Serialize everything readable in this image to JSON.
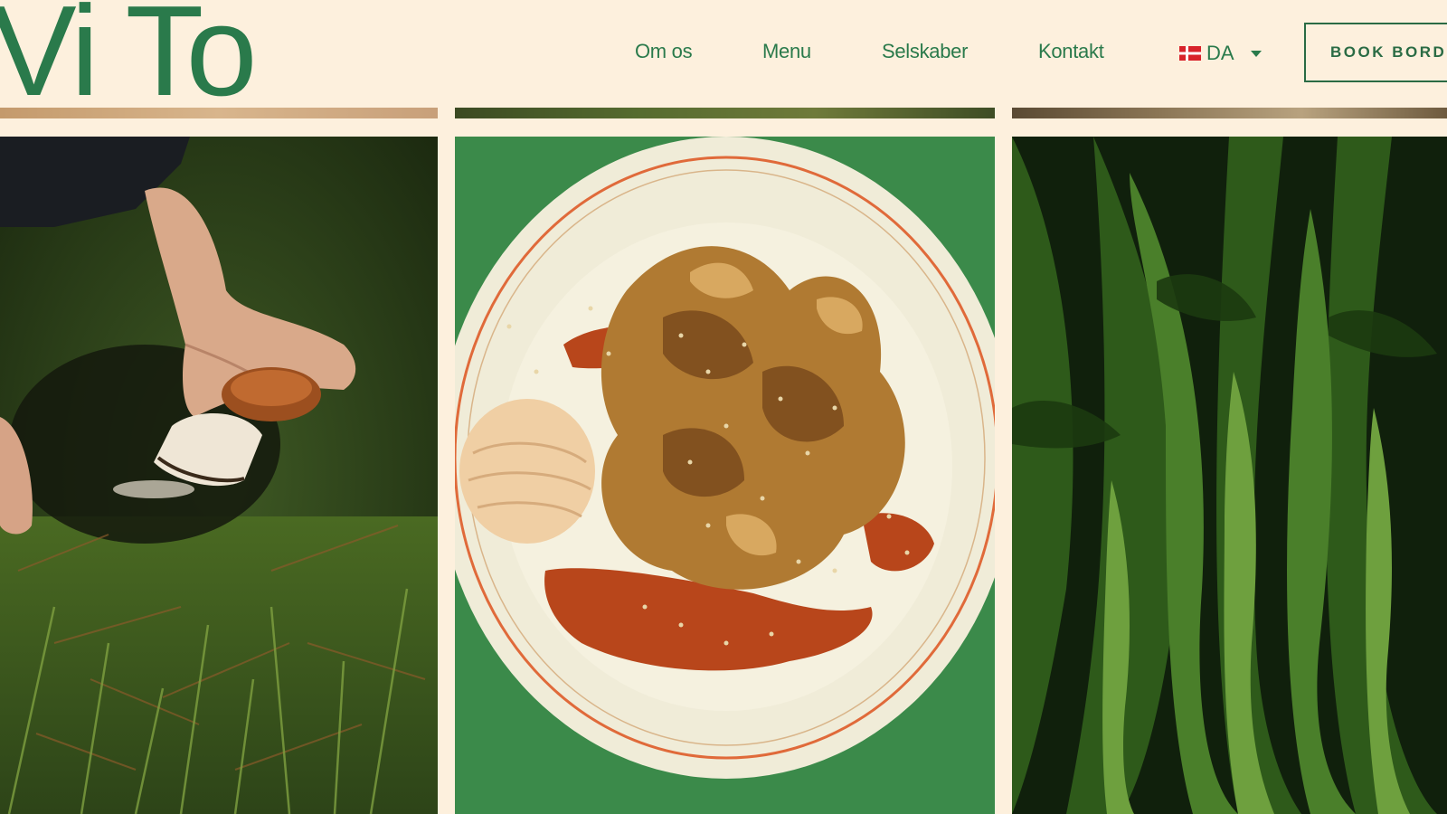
{
  "brand": {
    "logo_text": "Vi To",
    "accent_color": "#2a7a4b",
    "background": "#fdf0dd"
  },
  "nav": {
    "items": [
      {
        "label": "Om os"
      },
      {
        "label": "Menu"
      },
      {
        "label": "Selskaber"
      },
      {
        "label": "Kontakt"
      }
    ],
    "language": {
      "label": "DA",
      "flag": "danish-flag-icon"
    },
    "book_button": "BOOK BORD"
  },
  "photos": [
    {
      "subject": "forest-mushroom-foraging",
      "icon": "photo-icon"
    },
    {
      "subject": "fried-mushroom-dish",
      "icon": "photo-icon"
    },
    {
      "subject": "green-vegetable-stalks",
      "icon": "photo-icon"
    }
  ]
}
